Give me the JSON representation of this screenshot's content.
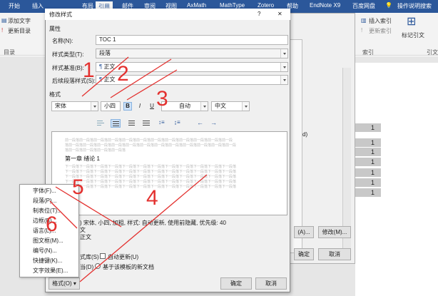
{
  "ribbon": {
    "tabs": [
      "开始",
      "插入",
      "布局",
      "引用",
      "邮件",
      "审阅",
      "视图",
      "AxMath",
      "MathType",
      "Zotero",
      "帮助",
      "EndNote X9",
      "百度网盘"
    ],
    "active_tab": "引用",
    "tell_me": "操作说明搜索",
    "add_text": "添加文字",
    "update_toc": "更新目录",
    "toc_group": "目录",
    "insert_index": "插入索引",
    "update_index": "更新索引",
    "index_group": "索引",
    "mark_citation": "标记引文",
    "cite_group": "引文目"
  },
  "document": {
    "toc_numbers": [
      "1",
      "1",
      "1",
      "1",
      "1",
      "1",
      "1"
    ]
  },
  "back_dialog": {
    "edge_text": "d)",
    "partial_field_label": "(A)...",
    "modify_button": "修改(M)...",
    "ok_button": "确定",
    "cancel_button": "取消"
  },
  "dialog": {
    "title": "修改样式",
    "help": "?",
    "close": "✕",
    "properties_section": "属性",
    "name_label": "名称(N):",
    "name_value": "TOC 1",
    "style_type_label": "样式类型(T):",
    "style_type_value": "段落",
    "based_on_label": "样式基准(B):",
    "based_on_value": "正文",
    "following_label": "后续段落样式(S):",
    "following_value": "正文",
    "format_section": "格式",
    "font_value": "宋体",
    "size_value": "小四",
    "bold": "B",
    "italic": "I",
    "underline": "U",
    "color_value": "自动",
    "script_value": "中文",
    "preview_prev_lines": [
      "前一段落前一段落前一段落前一段落前一段落前一段落前一段落前一段落前一段落前一段落前一段落前一段",
      "落前一段落前一段落前一段落前一段落前一段落前一段落前一段落前一段落前一段落前一段落前一段落前一段",
      "落前一段落前一段落前一段落前一段落"
    ],
    "preview_main": "第一章   绪论   1",
    "preview_next_lines": [
      "下一段落下一段落下一段落下一段落下一段落下一段落下一段落下一段落下一段落下一段落下一段落下一段落",
      "下一段落下一段落下一段落下一段落下一段落下一段落下一段落下一段落下一段落下一段落下一段落下一段落",
      "下一段落下一段落下一段落下一段落下一段落下一段落下一段落下一段落下一段落下一段落下一段落下一段落",
      "下一段落下一段落下一段落下一段落下一段落下一段落下一段落下一段落下一段落下一段落下一段落下一段落",
      "下一段落下一段落下一段落下一段落下一段落下一段落下一段落下一段落下一段落下一段落下一段落下一段落"
    ],
    "desc_line1": ") 宋体, 小四, 加粗, 样式: 自动更新, 使用前隐藏, 优先级: 40",
    "desc_line2": "文",
    "desc_line3": "正文",
    "add_gallery_tail": "式库(S)",
    "auto_update": "自动更新(U)",
    "this_doc_tail": "当(D)",
    "new_docs": "基于该模板的新文档",
    "format_button": "格式(O) ▾",
    "ok": "确定",
    "cancel": "取消"
  },
  "format_menu": {
    "items": [
      "字体(F)...",
      "段落(P)...",
      "制表位(T)...",
      "边框(B)...",
      "语言(L)...",
      "图文框(M)...",
      "编号(N)...",
      "快捷键(K)...",
      "文字效果(E)..."
    ]
  },
  "annotations": {
    "numbers": [
      "1",
      "2",
      "3",
      "4",
      "5",
      "6"
    ],
    "color": "#e3312f"
  },
  "colors": {
    "ribbon_blue": "#2b579a",
    "highlight": "#cde1f7"
  }
}
